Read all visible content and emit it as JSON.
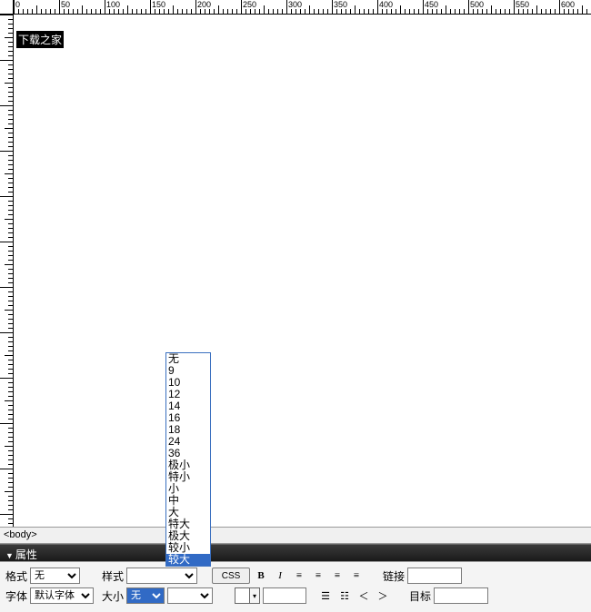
{
  "ruler": {
    "labels": [
      "0",
      "50",
      "100",
      "150",
      "200",
      "250",
      "300",
      "350",
      "400",
      "450",
      "500",
      "550",
      "600"
    ]
  },
  "canvas": {
    "sample_text": "下载之家"
  },
  "status": {
    "path": "<body>"
  },
  "panel": {
    "title": "属性"
  },
  "props": {
    "format_label": "格式",
    "format_value": "无",
    "style_label": "样式",
    "style_value": "",
    "css_btn": "CSS",
    "link_label": "链接",
    "font_label": "字体",
    "font_value": "默认字体",
    "size_label": "大小",
    "size_value": "无",
    "target_label": "目标"
  },
  "size_options": [
    "无",
    "9",
    "10",
    "12",
    "14",
    "16",
    "18",
    "24",
    "36",
    "极小",
    "特小",
    "小",
    "中",
    "大",
    "特大",
    "极大",
    "较小",
    "较大"
  ],
  "size_selected": "较大"
}
